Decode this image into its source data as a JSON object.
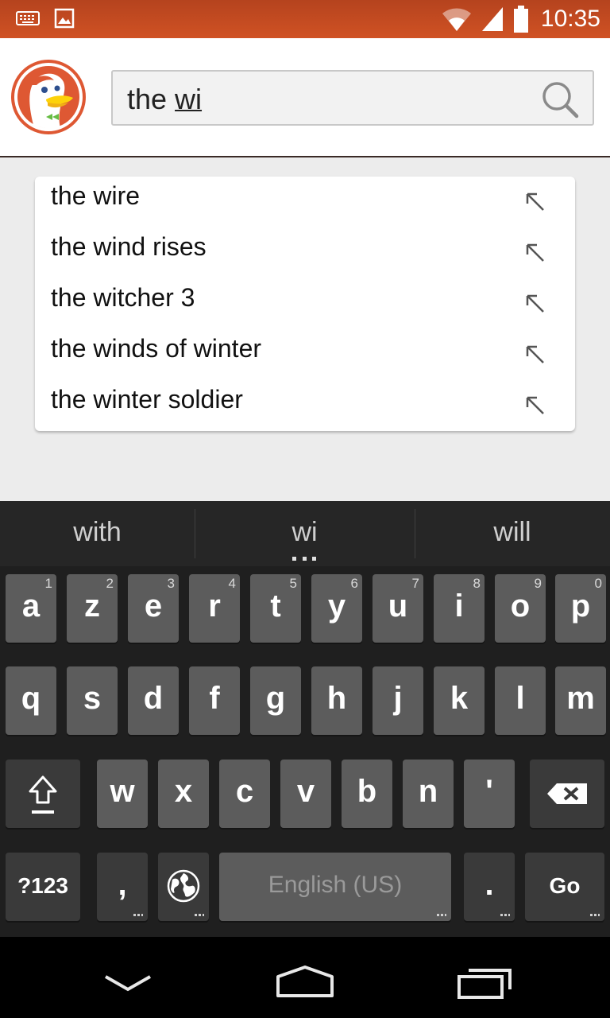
{
  "status_bar": {
    "time": "10:35",
    "left_icons": [
      "keyboard-icon",
      "image-icon"
    ],
    "right_icons": [
      "wifi-icon",
      "signal-icon",
      "battery-icon"
    ]
  },
  "header": {
    "logo": "duckduckgo-logo",
    "search": {
      "typed": "the ",
      "composing": "wi"
    }
  },
  "suggestions": [
    {
      "label": "the wire"
    },
    {
      "label": "the wind rises"
    },
    {
      "label": "the witcher 3"
    },
    {
      "label": "the winds of winter"
    },
    {
      "label": "the winter soldier"
    }
  ],
  "keyboard": {
    "candidates": [
      "with",
      "wi",
      "will"
    ],
    "row1": [
      {
        "label": "a",
        "hint": "1"
      },
      {
        "label": "z",
        "hint": "2"
      },
      {
        "label": "e",
        "hint": "3"
      },
      {
        "label": "r",
        "hint": "4"
      },
      {
        "label": "t",
        "hint": "5"
      },
      {
        "label": "y",
        "hint": "6"
      },
      {
        "label": "u",
        "hint": "7"
      },
      {
        "label": "i",
        "hint": "8"
      },
      {
        "label": "o",
        "hint": "9"
      },
      {
        "label": "p",
        "hint": "0"
      }
    ],
    "row2": [
      "q",
      "s",
      "d",
      "f",
      "g",
      "h",
      "j",
      "k",
      "l",
      "m"
    ],
    "row3": [
      "w",
      "x",
      "c",
      "v",
      "b",
      "n",
      "'"
    ],
    "symbols_label": "?123",
    "comma_label": ",",
    "space_label": "English (US)",
    "period_label": ".",
    "go_label": "Go"
  },
  "navbar": [
    "back-icon",
    "home-icon",
    "recents-icon"
  ]
}
